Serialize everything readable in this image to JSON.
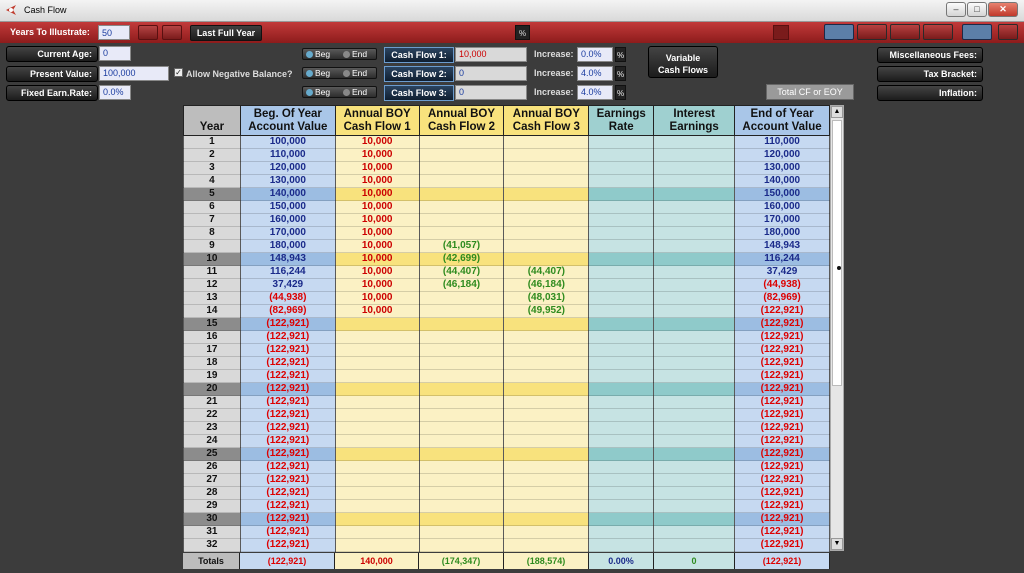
{
  "window": {
    "title": "Cash Flow"
  },
  "toolbar": {
    "years_label": "Years To Illustrate:",
    "years_value": "50",
    "last_full_year": "Last Full Year",
    "pct_symbol": "%"
  },
  "inputs": {
    "current_age_label": "Current Age:",
    "current_age": "0",
    "present_value_label": "Present Value:",
    "present_value": "100,000",
    "fixed_earn_label": "Fixed Earn.Rate:",
    "fixed_earn": "0.0%",
    "allow_negative_label": "Allow Negative Balance?",
    "allow_negative": "✓",
    "beg": "Beg",
    "end": "End",
    "cash_flows": [
      {
        "label": "Cash Flow 1:",
        "value": "10,000",
        "increase_label": "Increase:",
        "increase": "0.0%"
      },
      {
        "label": "Cash Flow 2:",
        "value": "0",
        "increase_label": "Increase:",
        "increase": "4.0%"
      },
      {
        "label": "Cash Flow 3:",
        "value": "0",
        "increase_label": "Increase:",
        "increase": "4.0%"
      }
    ],
    "pct": "%",
    "variable_cash_flows": "Variable\nCash Flows",
    "misc_fees": "Miscellaneous Fees:",
    "tax_bracket": "Tax Bracket:",
    "inflation": "Inflation:",
    "total_cf": "Total CF or EOY"
  },
  "table": {
    "headers": [
      "Year",
      "Beg. Of Year\nAccount Value",
      "Annual BOY\nCash Flow 1",
      "Annual BOY\nCash Flow 2",
      "Annual BOY\nCash Flow 3",
      "Earnings\nRate",
      "Interest\nEarnings",
      "End of Year\nAccount Value"
    ],
    "rows": [
      [
        "1",
        "100,000",
        "10,000",
        "",
        "",
        "",
        "",
        "110,000"
      ],
      [
        "2",
        "110,000",
        "10,000",
        "",
        "",
        "",
        "",
        "120,000"
      ],
      [
        "3",
        "120,000",
        "10,000",
        "",
        "",
        "",
        "",
        "130,000"
      ],
      [
        "4",
        "130,000",
        "10,000",
        "",
        "",
        "",
        "",
        "140,000"
      ],
      [
        "5",
        "140,000",
        "10,000",
        "",
        "",
        "",
        "",
        "150,000"
      ],
      [
        "6",
        "150,000",
        "10,000",
        "",
        "",
        "",
        "",
        "160,000"
      ],
      [
        "7",
        "160,000",
        "10,000",
        "",
        "",
        "",
        "",
        "170,000"
      ],
      [
        "8",
        "170,000",
        "10,000",
        "",
        "",
        "",
        "",
        "180,000"
      ],
      [
        "9",
        "180,000",
        "10,000",
        "(41,057)",
        "",
        "",
        "",
        "148,943"
      ],
      [
        "10",
        "148,943",
        "10,000",
        "(42,699)",
        "",
        "",
        "",
        "116,244"
      ],
      [
        "11",
        "116,244",
        "10,000",
        "(44,407)",
        "(44,407)",
        "",
        "",
        "37,429"
      ],
      [
        "12",
        "37,429",
        "10,000",
        "(46,184)",
        "(46,184)",
        "",
        "",
        "(44,938)"
      ],
      [
        "13",
        "(44,938)",
        "10,000",
        "",
        "(48,031)",
        "",
        "",
        "(82,969)"
      ],
      [
        "14",
        "(82,969)",
        "10,000",
        "",
        "(49,952)",
        "",
        "",
        "(122,921)"
      ],
      [
        "15",
        "(122,921)",
        "",
        "",
        "",
        "",
        "",
        "(122,921)"
      ],
      [
        "16",
        "(122,921)",
        "",
        "",
        "",
        "",
        "",
        "(122,921)"
      ],
      [
        "17",
        "(122,921)",
        "",
        "",
        "",
        "",
        "",
        "(122,921)"
      ],
      [
        "18",
        "(122,921)",
        "",
        "",
        "",
        "",
        "",
        "(122,921)"
      ],
      [
        "19",
        "(122,921)",
        "",
        "",
        "",
        "",
        "",
        "(122,921)"
      ],
      [
        "20",
        "(122,921)",
        "",
        "",
        "",
        "",
        "",
        "(122,921)"
      ],
      [
        "21",
        "(122,921)",
        "",
        "",
        "",
        "",
        "",
        "(122,921)"
      ],
      [
        "22",
        "(122,921)",
        "",
        "",
        "",
        "",
        "",
        "(122,921)"
      ],
      [
        "23",
        "(122,921)",
        "",
        "",
        "",
        "",
        "",
        "(122,921)"
      ],
      [
        "24",
        "(122,921)",
        "",
        "",
        "",
        "",
        "",
        "(122,921)"
      ],
      [
        "25",
        "(122,921)",
        "",
        "",
        "",
        "",
        "",
        "(122,921)"
      ],
      [
        "26",
        "(122,921)",
        "",
        "",
        "",
        "",
        "",
        "(122,921)"
      ],
      [
        "27",
        "(122,921)",
        "",
        "",
        "",
        "",
        "",
        "(122,921)"
      ],
      [
        "28",
        "(122,921)",
        "",
        "",
        "",
        "",
        "",
        "(122,921)"
      ],
      [
        "29",
        "(122,921)",
        "",
        "",
        "",
        "",
        "",
        "(122,921)"
      ],
      [
        "30",
        "(122,921)",
        "",
        "",
        "",
        "",
        "",
        "(122,921)"
      ],
      [
        "31",
        "(122,921)",
        "",
        "",
        "",
        "",
        "",
        "(122,921)"
      ],
      [
        "32",
        "(122,921)",
        "",
        "",
        "",
        "",
        "",
        "(122,921)"
      ]
    ],
    "highlight_years": [
      "5",
      "10",
      "15",
      "20",
      "25",
      "30"
    ],
    "totals": [
      "Totals",
      "(122,921)",
      "140,000",
      "(174,347)",
      "(188,574)",
      "0.00%",
      "0",
      "(122,921)"
    ]
  },
  "colors": {
    "red_bar": "#a82a2a",
    "account_blue": "#c6d9f1",
    "cashflow_yellow": "#fbf1c4",
    "earnings_teal": "#c6e3e3"
  },
  "icons": [
    "app-icon",
    "minimize-icon",
    "maximize-icon",
    "close-icon",
    "percent-icon",
    "lock-icon",
    "scroll-up-icon",
    "scroll-down-icon"
  ]
}
